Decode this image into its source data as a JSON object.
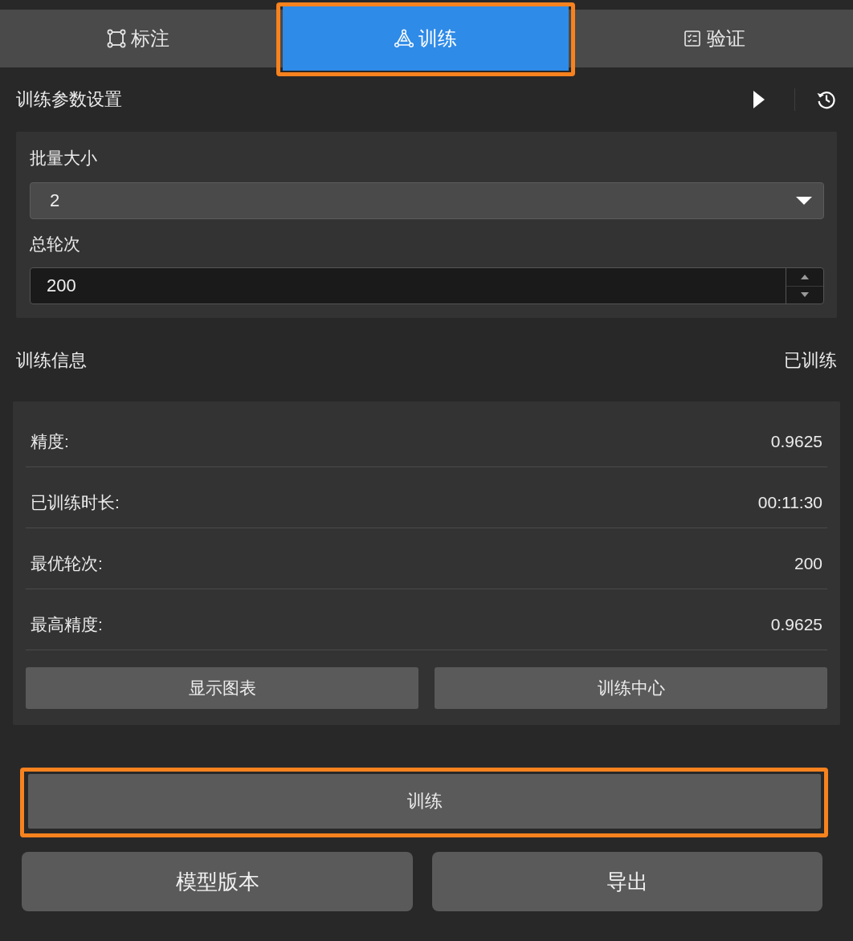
{
  "tabs": [
    {
      "label": "标注",
      "selected": false,
      "highlighted": false
    },
    {
      "label": "训练",
      "selected": true,
      "highlighted": true
    },
    {
      "label": "验证",
      "selected": false,
      "highlighted": false
    }
  ],
  "train_params": {
    "title": "训练参数设置",
    "fields": [
      {
        "kind": "dropdown",
        "label": "批量大小",
        "value": "2"
      },
      {
        "kind": "spinbox",
        "label": "总轮次",
        "value": "200"
      }
    ]
  },
  "train_info": {
    "title": "训练信息",
    "status": "已训练",
    "metrics": [
      {
        "label": "精度:",
        "value": "0.9625"
      },
      {
        "label": "已训练时长:",
        "value": "00:11:30"
      },
      {
        "label": "最优轮次:",
        "value": "200"
      },
      {
        "label": "最高精度:",
        "value": "0.9625"
      }
    ],
    "buttons": [
      "显示图表",
      "训练中心"
    ]
  },
  "train_button": {
    "label": "训练",
    "highlighted": true
  },
  "bottom_buttons": [
    "模型版本",
    "导出"
  ]
}
